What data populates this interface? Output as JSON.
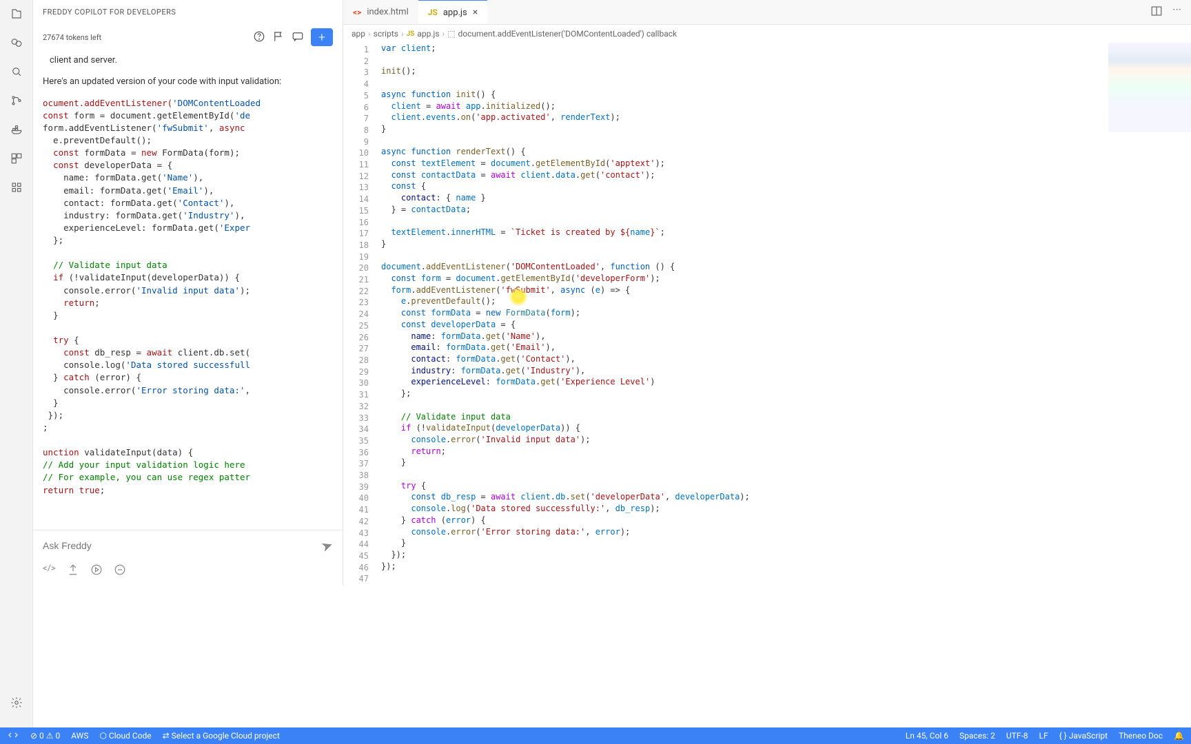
{
  "sidebar": {
    "title": "FREDDY COPILOT FOR DEVELOPERS",
    "tokens": "27674 tokens left",
    "new_btn": "+",
    "input_placeholder": "Ask Freddy",
    "chat_line1": "client and server.",
    "chat_para": "Here's an updated version of your code with input validation:",
    "chat_code": [
      "<span class='ck-kw'>ocument.addEventListener(</span><span class='ck-str'>'DOMContentLoaded</span>",
      "<span class='ck-kw'>const</span> form = document.getElementById(<span class='ck-str'>'de</span>",
      "form.addEventListener(<span class='ck-str'>'fwSubmit'</span>, <span class='ck-kw'>async</span>",
      "  e.preventDefault();",
      "  <span class='ck-kw'>const</span> formData = <span class='ck-kw'>new</span> FormData(form);",
      "  <span class='ck-kw'>const</span> developerData = {",
      "    name: formData.get(<span class='ck-str'>'Name'</span>),",
      "    email: formData.get(<span class='ck-str'>'Email'</span>),",
      "    contact: formData.get(<span class='ck-str'>'Contact'</span>),",
      "    industry: formData.get(<span class='ck-str'>'Industry'</span>),",
      "    experienceLevel: formData.get(<span class='ck-str'>'Exper</span>",
      "  };",
      "",
      "  <span class='ck-cm'>// Validate input data</span>",
      "  <span class='ck-kw'>if</span> (!validateInput(developerData)) {",
      "    console.error(<span class='ck-str'>'Invalid input data'</span>);",
      "    <span class='ck-kw'>return</span>;",
      "  }",
      "",
      "  <span class='ck-kw'>try</span> {",
      "    <span class='ck-kw'>const</span> db_resp = <span class='ck-kw'>await</span> client.db.set(",
      "    console.log(<span class='ck-str'>'Data stored successfull</span>",
      "  } <span class='ck-kw'>catch</span> (error) {",
      "    console.error(<span class='ck-str'>'Error storing data:'</span>,",
      "  }",
      " });",
      ";",
      "",
      "<span class='ck-kw'>unction</span> validateInput(data) {",
      "<span class='ck-cm'>// Add your input validation logic here</span>",
      "<span class='ck-cm'>// For example, you can use regex patter</span>",
      "<span class='ck-kw'>return true</span>;"
    ]
  },
  "tabs": {
    "html": "index.html",
    "js": "app.js"
  },
  "breadcrumb": {
    "p1": "app",
    "p2": "scripts",
    "p3": "app.js",
    "p4": "document.addEventListener('DOMContentLoaded') callback"
  },
  "code": [
    "<span class='kw'>var</span> <span class='var'>client</span>;",
    "",
    "<span class='fn'>init</span>();",
    "",
    "<span class='kw'>async</span> <span class='kw'>function</span> <span class='fn'>init</span>() {",
    "  <span class='var'>client</span> = <span class='kw2'>await</span> <span class='var'>app</span>.<span class='fn'>initialized</span>();",
    "  <span class='var'>client</span>.<span class='var'>events</span>.<span class='fn'>on</span>(<span class='str'>'app.activated'</span>, <span class='var'>renderText</span>);",
    "}",
    "",
    "<span class='kw'>async</span> <span class='kw'>function</span> <span class='fn'>renderText</span>() {",
    "  <span class='kw'>const</span> <span class='var'>textElement</span> = <span class='var'>document</span>.<span class='fn'>getElementById</span>(<span class='str'>'apptext'</span>);",
    "  <span class='kw'>const</span> <span class='var'>contactData</span> = <span class='kw2'>await</span> <span class='var'>client</span>.<span class='var'>data</span>.<span class='fn'>get</span>(<span class='str'>'contact'</span>);",
    "  <span class='kw'>const</span> {",
    "    <span class='prop'>contact</span>: { <span class='var'>name</span> }",
    "  } = <span class='var'>contactData</span>;",
    "",
    "  <span class='var'>textElement</span>.<span class='var'>innerHTML</span> = <span class='tpl'>`Ticket is created by ${</span><span class='var'>name</span><span class='tpl'>}`</span>;",
    "}",
    "",
    "<span class='var'>document</span>.<span class='fn'>addEventListener</span>(<span class='str'>'DOMContentLoaded'</span>, <span class='kw'>function</span> () {",
    "  <span class='kw'>const</span> <span class='var'>form</span> = <span class='var'>document</span>.<span class='fn'>getElementById</span>(<span class='str'>'developerForm'</span>);",
    "  <span class='var'>form</span>.<span class='fn'>addEventListener</span>(<span class='str'>'fwSubmit'</span>, <span class='kw'>async</span> (<span class='var'>e</span>) =&gt; {",
    "    <span class='var'>e</span>.<span class='fn'>preventDefault</span>();",
    "    <span class='kw'>const</span> <span class='var'>formData</span> = <span class='kw'>new</span> <span class='type'>FormData</span>(<span class='var'>form</span>);",
    "    <span class='kw'>const</span> <span class='var'>developerData</span> = {",
    "      <span class='prop'>name</span>: <span class='var'>formData</span>.<span class='fn'>get</span>(<span class='str'>'Name'</span>),",
    "      <span class='prop'>email</span>: <span class='var'>formData</span>.<span class='fn'>get</span>(<span class='str'>'Email'</span>),",
    "      <span class='prop'>contact</span>: <span class='var'>formData</span>.<span class='fn'>get</span>(<span class='str'>'Contact'</span>),",
    "      <span class='prop'>industry</span>: <span class='var'>formData</span>.<span class='fn'>get</span>(<span class='str'>'Industry'</span>),",
    "      <span class='prop'>experienceLevel</span>: <span class='var'>formData</span>.<span class='fn'>get</span>(<span class='str'>'Experience Level'</span>)",
    "    };",
    "",
    "    <span class='comm'>// Validate input data</span>",
    "    <span class='kw2'>if</span> (!<span class='fn'>validateInput</span>(<span class='var'>developerData</span>)) {",
    "      <span class='var'>console</span>.<span class='fn'>error</span>(<span class='str'>'Invalid input data'</span>);",
    "      <span class='kw2'>return</span>;",
    "    }",
    "",
    "    <span class='kw2'>try</span> {",
    "      <span class='kw'>const</span> <span class='var'>db_resp</span> = <span class='kw2'>await</span> <span class='var'>client</span>.<span class='var'>db</span>.<span class='fn'>set</span>(<span class='str'>'developerData'</span>, <span class='var'>developerData</span>);",
    "      <span class='var'>console</span>.<span class='fn'>log</span>(<span class='str'>'Data stored successfully:'</span>, <span class='var'>db_resp</span>);",
    "    } <span class='kw2'>catch</span> (<span class='var'>error</span>) {",
    "      <span class='var'>console</span>.<span class='fn'>error</span>(<span class='str'>'Error storing data:'</span>, <span class='var'>error</span>);",
    "    }",
    "  });",
    "});",
    ""
  ],
  "status": {
    "errors": "0",
    "warnings": "0",
    "aws": "AWS",
    "cloud": "Cloud Code",
    "gcloud": "Select a Google Cloud project",
    "ln": "Ln 45, Col 6",
    "spaces": "Spaces: 2",
    "encoding": "UTF-8",
    "eol": "LF",
    "lang": "JavaScript",
    "theneo": "Theneo Doc",
    "bell": "…"
  }
}
